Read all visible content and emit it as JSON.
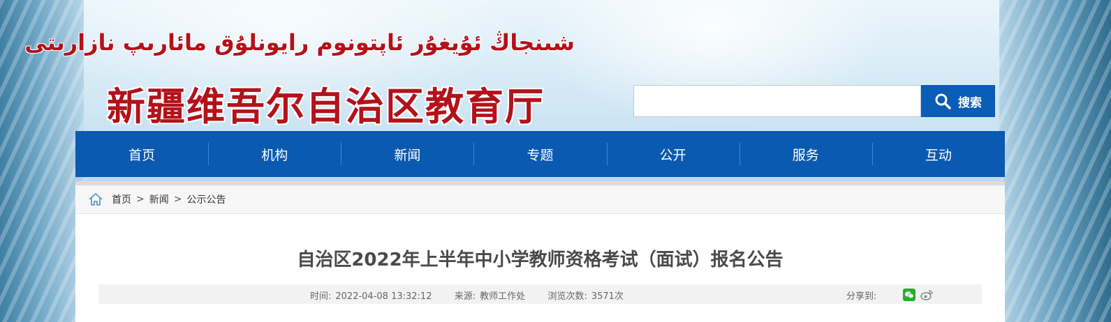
{
  "header": {
    "uyghur_title": "شىنجاڭ ئۇيغۇر ئاپتونوم رايونلۇق مائارىپ نازارىتى",
    "site_title": "新疆维吾尔自治区教育厅"
  },
  "search": {
    "placeholder": "",
    "value": "",
    "button_label": "搜索",
    "icon": "search-icon"
  },
  "nav": {
    "items": [
      {
        "label": "首页"
      },
      {
        "label": "机构"
      },
      {
        "label": "新闻"
      },
      {
        "label": "专题"
      },
      {
        "label": "公开"
      },
      {
        "label": "服务"
      },
      {
        "label": "互动"
      }
    ]
  },
  "breadcrumb": {
    "icon": "home-icon",
    "items": [
      "首页",
      "新闻",
      "公示公告"
    ],
    "separator": ">"
  },
  "article": {
    "title": "自治区2022年上半年中小学教师资格考试（面试）报名公告",
    "time_label": "时间:",
    "time_value": "2022-04-08 13:32:12",
    "source_label": "来源:",
    "source_value": "教师工作处",
    "views_label": "浏览次数:",
    "views_value": "3571次",
    "share_label": "分享到:"
  },
  "colors": {
    "brand_red": "#b3121b",
    "nav_blue": "#0b5ab1",
    "search_blue": "#0b5cb5"
  }
}
